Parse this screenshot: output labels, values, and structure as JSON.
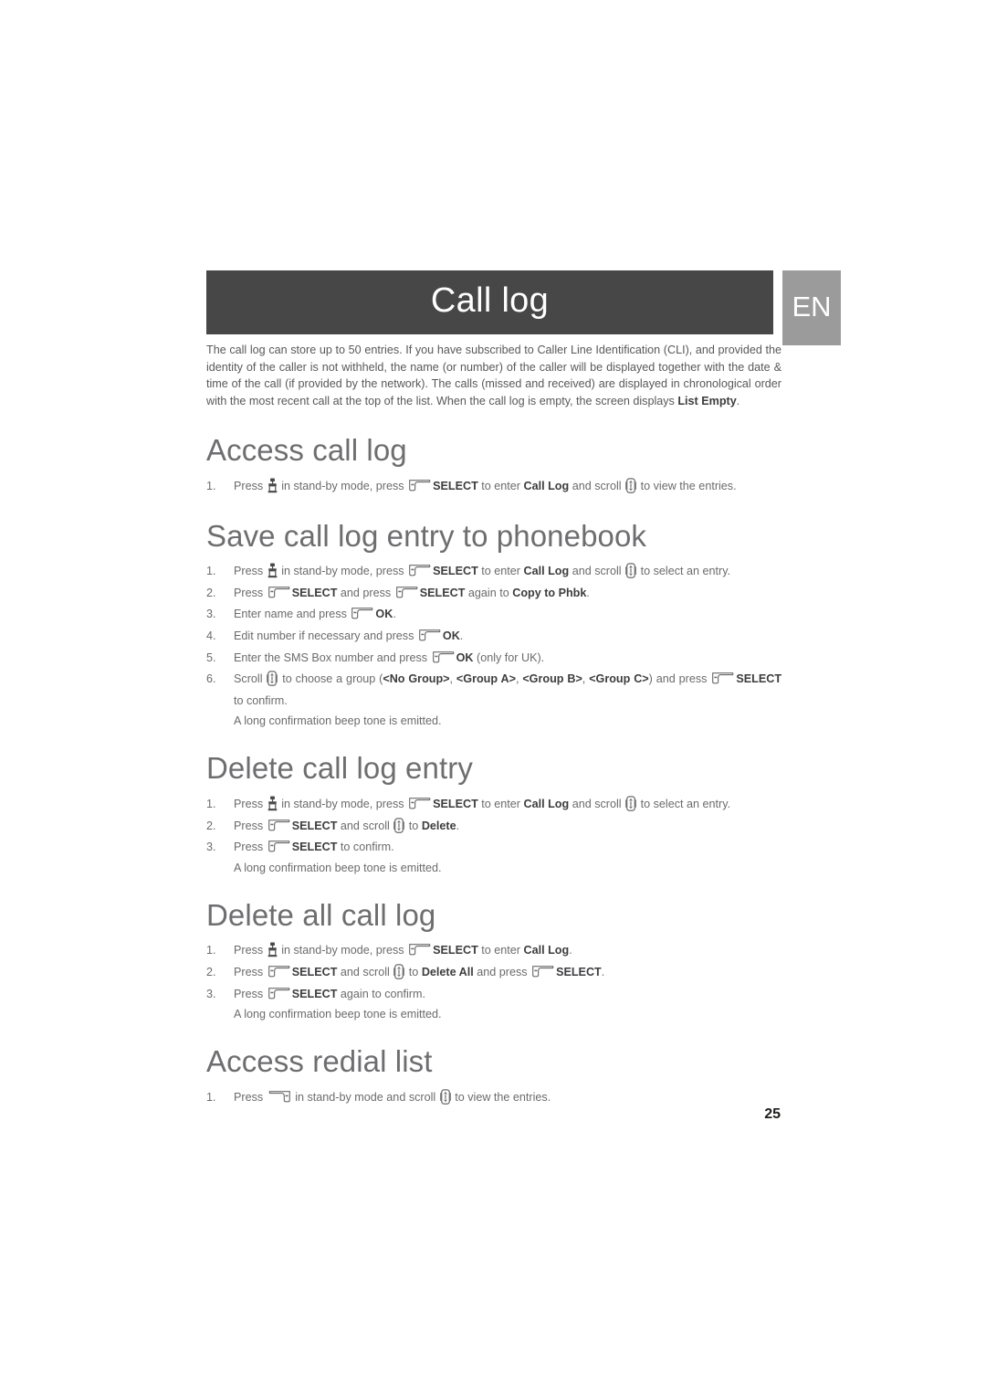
{
  "header": {
    "title": "Call log",
    "language_badge": "EN"
  },
  "intro": {
    "text_before_bold": "The call log can store up to 50 entries. If you have subscribed to Caller Line Identification (CLI), and provided the identity of the caller is not withheld, the name (or number) of the caller will be displayed together with the date & time of the call (if provided by the network). The calls (missed and received) are displayed in chronological order with the most recent call at the top of the list. When the call log is empty, the screen displays ",
    "bold_term": "List Empty",
    "text_after_bold": "."
  },
  "icons": {
    "softkey": "softkey-select-icon",
    "softkey_right": "softkey-redial-icon",
    "scroll": "scroll-updown-icon",
    "menu": "menu-key-icon"
  },
  "sections": [
    {
      "title": "Access call log",
      "steps": [
        {
          "number": "1.",
          "parts": [
            {
              "t": "text",
              "v": "Press "
            },
            {
              "t": "icon",
              "v": "menu"
            },
            {
              "t": "text",
              "v": " in stand-by mode, press "
            },
            {
              "t": "icon",
              "v": "softkey"
            },
            {
              "t": "bold",
              "v": "SELECT"
            },
            {
              "t": "text",
              "v": " to enter "
            },
            {
              "t": "bold",
              "v": "Call Log"
            },
            {
              "t": "text",
              "v": " and scroll "
            },
            {
              "t": "icon",
              "v": "scroll"
            },
            {
              "t": "text",
              "v": " to view the entries."
            }
          ]
        }
      ]
    },
    {
      "title": "Save call log entry to phonebook",
      "steps": [
        {
          "number": "1.",
          "parts": [
            {
              "t": "text",
              "v": "Press "
            },
            {
              "t": "icon",
              "v": "menu"
            },
            {
              "t": "text",
              "v": " in stand-by mode, press "
            },
            {
              "t": "icon",
              "v": "softkey"
            },
            {
              "t": "bold",
              "v": "SELECT"
            },
            {
              "t": "text",
              "v": " to enter "
            },
            {
              "t": "bold",
              "v": "Call Log"
            },
            {
              "t": "text",
              "v": " and scroll "
            },
            {
              "t": "icon",
              "v": "scroll"
            },
            {
              "t": "text",
              "v": " to select an entry."
            }
          ]
        },
        {
          "number": "2.",
          "parts": [
            {
              "t": "text",
              "v": "Press "
            },
            {
              "t": "icon",
              "v": "softkey"
            },
            {
              "t": "bold",
              "v": "SELECT"
            },
            {
              "t": "text",
              "v": " and press "
            },
            {
              "t": "icon",
              "v": "softkey"
            },
            {
              "t": "bold",
              "v": "SELECT"
            },
            {
              "t": "text",
              "v": " again to "
            },
            {
              "t": "bold",
              "v": "Copy to Phbk"
            },
            {
              "t": "text",
              "v": "."
            }
          ]
        },
        {
          "number": "3.",
          "parts": [
            {
              "t": "text",
              "v": "Enter name and press "
            },
            {
              "t": "icon",
              "v": "softkey"
            },
            {
              "t": "bold",
              "v": "OK"
            },
            {
              "t": "text",
              "v": "."
            }
          ]
        },
        {
          "number": "4.",
          "parts": [
            {
              "t": "text",
              "v": "Edit number if necessary and press "
            },
            {
              "t": "icon",
              "v": "softkey"
            },
            {
              "t": "bold",
              "v": "OK"
            },
            {
              "t": "text",
              "v": "."
            }
          ]
        },
        {
          "number": "5.",
          "parts": [
            {
              "t": "text",
              "v": "Enter the SMS Box number and press "
            },
            {
              "t": "icon",
              "v": "softkey"
            },
            {
              "t": "bold",
              "v": "OK"
            },
            {
              "t": "text",
              "v": " (only for UK)."
            }
          ]
        },
        {
          "number": "6.",
          "justify": true,
          "parts": [
            {
              "t": "text",
              "v": "Scroll "
            },
            {
              "t": "icon",
              "v": "scroll"
            },
            {
              "t": "text",
              "v": " to choose a group ("
            },
            {
              "t": "bold",
              "v": "<No Group>"
            },
            {
              "t": "text",
              "v": ", "
            },
            {
              "t": "bold",
              "v": "<Group A>"
            },
            {
              "t": "text",
              "v": ", "
            },
            {
              "t": "bold",
              "v": "<Group B>"
            },
            {
              "t": "text",
              "v": ", "
            },
            {
              "t": "bold",
              "v": "<Group C>"
            },
            {
              "t": "text",
              "v": ") and press "
            },
            {
              "t": "icon",
              "v": "softkey"
            },
            {
              "t": "bold",
              "v": "SELECT"
            },
            {
              "t": "text",
              "v": " to confirm."
            }
          ],
          "note": "A long confirmation beep tone is emitted."
        }
      ]
    },
    {
      "title": "Delete call log entry",
      "steps": [
        {
          "number": "1.",
          "parts": [
            {
              "t": "text",
              "v": "Press "
            },
            {
              "t": "icon",
              "v": "menu"
            },
            {
              "t": "text",
              "v": " in stand-by mode, press "
            },
            {
              "t": "icon",
              "v": "softkey"
            },
            {
              "t": "bold",
              "v": "SELECT"
            },
            {
              "t": "text",
              "v": " to enter "
            },
            {
              "t": "bold",
              "v": "Call Log"
            },
            {
              "t": "text",
              "v": " and scroll "
            },
            {
              "t": "icon",
              "v": "scroll"
            },
            {
              "t": "text",
              "v": " to select an entry."
            }
          ]
        },
        {
          "number": "2.",
          "parts": [
            {
              "t": "text",
              "v": "Press "
            },
            {
              "t": "icon",
              "v": "softkey"
            },
            {
              "t": "bold",
              "v": "SELECT"
            },
            {
              "t": "text",
              "v": " and scroll "
            },
            {
              "t": "icon",
              "v": "scroll"
            },
            {
              "t": "text",
              "v": " to "
            },
            {
              "t": "bold",
              "v": "Delete"
            },
            {
              "t": "text",
              "v": "."
            }
          ]
        },
        {
          "number": "3.",
          "parts": [
            {
              "t": "text",
              "v": "Press "
            },
            {
              "t": "icon",
              "v": "softkey"
            },
            {
              "t": "bold",
              "v": "SELECT"
            },
            {
              "t": "text",
              "v": " to confirm."
            }
          ],
          "note": "A long confirmation beep tone is emitted."
        }
      ]
    },
    {
      "title": "Delete all call log",
      "steps": [
        {
          "number": "1.",
          "parts": [
            {
              "t": "text",
              "v": "Press "
            },
            {
              "t": "icon",
              "v": "menu"
            },
            {
              "t": "text",
              "v": " in stand-by mode, press "
            },
            {
              "t": "icon",
              "v": "softkey"
            },
            {
              "t": "bold",
              "v": "SELECT"
            },
            {
              "t": "text",
              "v": " to enter "
            },
            {
              "t": "bold",
              "v": "Call Log"
            },
            {
              "t": "text",
              "v": "."
            }
          ]
        },
        {
          "number": "2.",
          "parts": [
            {
              "t": "text",
              "v": "Press "
            },
            {
              "t": "icon",
              "v": "softkey"
            },
            {
              "t": "bold",
              "v": "SELECT"
            },
            {
              "t": "text",
              "v": " and scroll "
            },
            {
              "t": "icon",
              "v": "scroll"
            },
            {
              "t": "text",
              "v": " to "
            },
            {
              "t": "bold",
              "v": "Delete All"
            },
            {
              "t": "text",
              "v": " and press "
            },
            {
              "t": "icon",
              "v": "softkey"
            },
            {
              "t": "bold",
              "v": "SELECT"
            },
            {
              "t": "text",
              "v": "."
            }
          ]
        },
        {
          "number": "3.",
          "parts": [
            {
              "t": "text",
              "v": "Press "
            },
            {
              "t": "icon",
              "v": "softkey"
            },
            {
              "t": "bold",
              "v": "SELECT"
            },
            {
              "t": "text",
              "v": " again to confirm."
            }
          ],
          "note": "A long confirmation beep tone is emitted."
        }
      ]
    },
    {
      "title": "Access redial list",
      "steps": [
        {
          "number": "1.",
          "parts": [
            {
              "t": "text",
              "v": "Press "
            },
            {
              "t": "icon",
              "v": "softkey_right"
            },
            {
              "t": "text",
              "v": " in stand-by mode and scroll "
            },
            {
              "t": "icon",
              "v": "scroll"
            },
            {
              "t": "text",
              "v": " to view the entries."
            }
          ]
        }
      ]
    }
  ],
  "page_number": "25",
  "colors": {
    "title_bar": "#474747",
    "lang_badge": "#9b9b9b",
    "heading": "#6e6e70",
    "body_text": "#6b6b6d",
    "bold_text": "#3d3d3f"
  }
}
